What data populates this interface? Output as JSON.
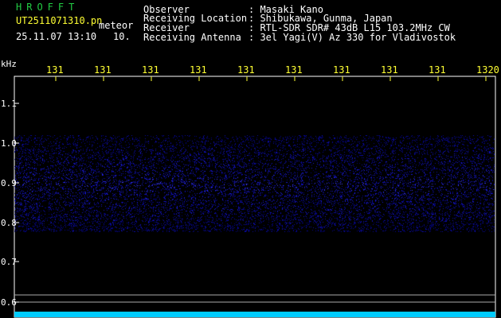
{
  "header": {
    "brand": "HROFFT",
    "filename": "UT2511071310.pn",
    "mode": "meteor",
    "datetime": "25.11.07 13:10",
    "count": "10."
  },
  "station": {
    "observer_label": "Observer",
    "observer_value": ": Masaki Kano",
    "location_label": "Receiving Location",
    "location_value": ": Shibukawa, Gunma, Japan",
    "receiver_label": "Receiver",
    "receiver_value": ": RTL-SDR SDR# 43dB L15 103.2MHz CW",
    "antenna_label": "Receiving Antenna",
    "antenna_value": ": 3el Yagi(V) Az 330 for Vladivostok"
  },
  "y_axis": {
    "unit": "kHz",
    "ticks": [
      "1.1",
      "1.0",
      "0.9",
      "0.8",
      "0.7",
      "0.6"
    ]
  },
  "x_axis": {
    "ticks": [
      "131",
      "131",
      "131",
      "131",
      "131",
      "131",
      "131",
      "131",
      "131",
      "1320"
    ]
  },
  "colors": {
    "background": "#000000",
    "axis": "#ffffff",
    "tick_label": "#ffff33",
    "brand": "#22cc44",
    "noise": "#2233ff",
    "baseline": "#00ccff"
  }
}
